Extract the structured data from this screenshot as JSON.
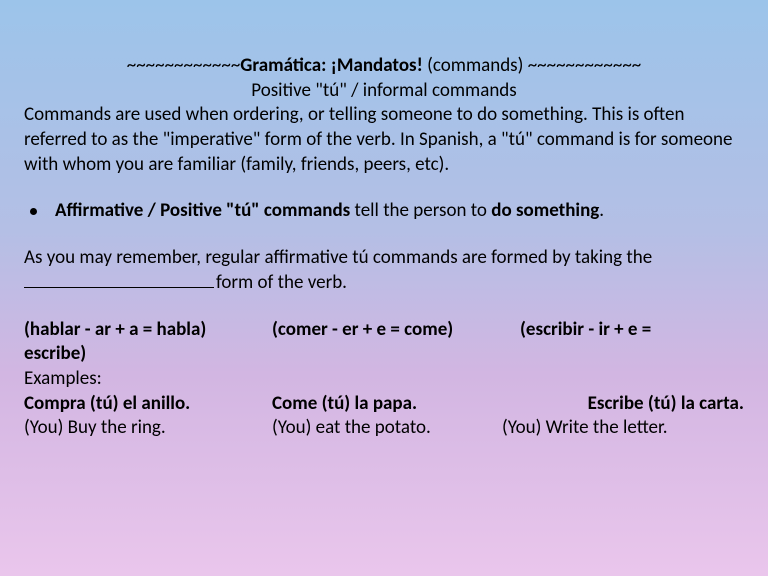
{
  "title_line": {
    "deco_left": "~~~~~~~~~~~~",
    "title_bold": "Gramática:  ¡Mandatos!",
    "title_plain": " (commands) ",
    "deco_right": "~~~~~~~~~~~~"
  },
  "subtitle": "Positive \"tú\" / informal commands",
  "intro": "Commands are used when ordering, or telling someone to do something. This is often referred to as the \"imperative\" form of the verb. In Spanish, a \"tú\" command is for someone with whom you are familiar (family, friends, peers, etc).",
  "bullet": {
    "bold1": "Affirmative / Positive \"tú\" commands",
    "mid": " tell the person to ",
    "bold2": "do something",
    "end": "."
  },
  "formation": {
    "lead": "As you may remember, regular affirmative tú commands are formed by taking the ",
    "tail": "form of the verb."
  },
  "conjugations": {
    "hablar": "(hablar - ar + a = habla)",
    "comer": "(comer - er + e = come)",
    "escribir_part1": "(escribir - ir + e =",
    "escribir_part2": "escribe)"
  },
  "examples_label": "Examples:",
  "examples": {
    "e1_cmd": "Compra (tú) el anillo.",
    "e1_tr": "(You) Buy the ring.",
    "e2_cmd": "Come (tú) la papa.",
    "e2_tr": "(You) eat the potato.",
    "e3_cmd": "Escribe (tú) la carta.",
    "e3_tr": "(You) Write the letter."
  }
}
